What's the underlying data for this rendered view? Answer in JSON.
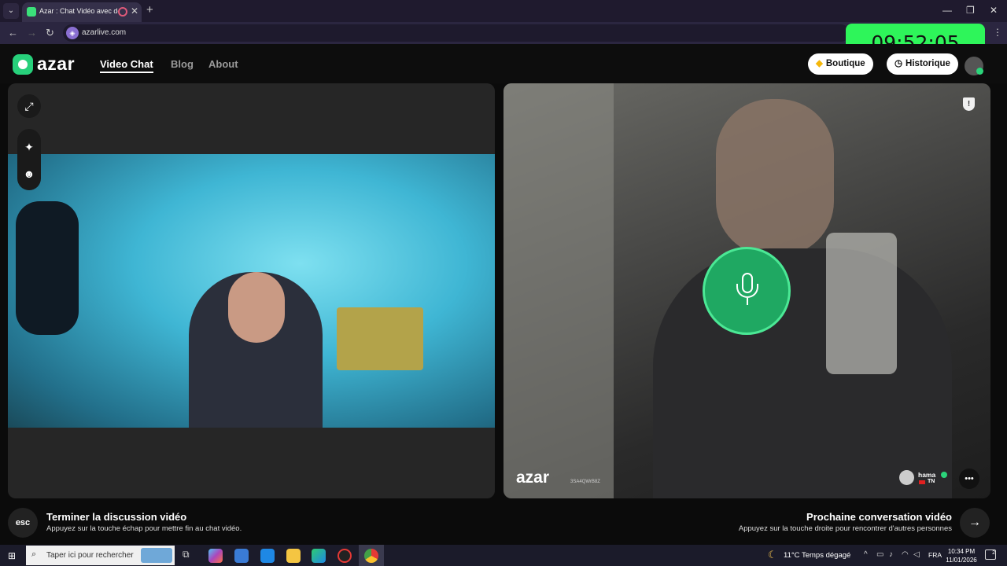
{
  "browser": {
    "tab_title": "Azar : Chat Vidéo avec de",
    "url": "azarlive.com",
    "new_tab": "+",
    "close_tab": "✕",
    "minimize": "—",
    "maximize": "❐",
    "close": "✕"
  },
  "clock": "09:52:05",
  "site": {
    "logo": "azar",
    "nav": [
      "Video Chat",
      "Blog",
      "About"
    ],
    "boutique_label": "Boutique",
    "historique_label": "Historique"
  },
  "partner": {
    "watermark_logo": "azar",
    "watermark_id": "3SA4QWrB8Z",
    "name": "hama",
    "country": "TN"
  },
  "bottom": {
    "esc_label": "esc",
    "end_title": "Terminer la discussion vidéo",
    "end_sub": "Appuyez sur la touche échap pour mettre fin au chat vidéo.",
    "next_title": "Prochaine conversation vidéo",
    "next_sub": "Appuyez sur la touche droite pour rencontrer d'autres personnes",
    "next_arrow": "→"
  },
  "taskbar": {
    "search_placeholder": "Taper ici pour rechercher",
    "weather": "11°C  Temps dégagé",
    "lang": "FRA",
    "time": "10:34 PM",
    "date": "11/01/2026",
    "notifications": "2"
  },
  "colors": {
    "brand_green": "#27d07b",
    "clock_bg": "#2ef55a",
    "mic_green": "#1fa862"
  }
}
